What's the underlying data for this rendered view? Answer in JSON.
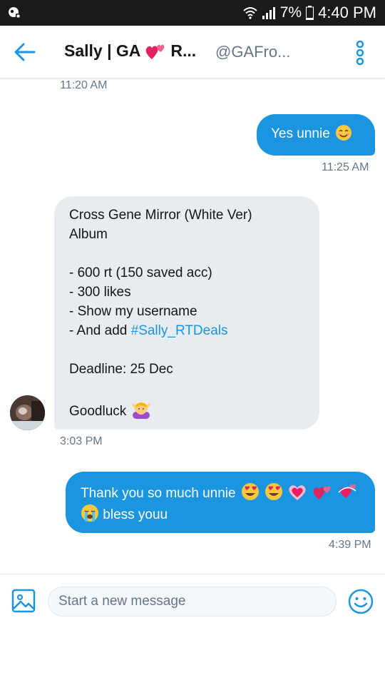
{
  "status_bar": {
    "battery": "7%",
    "time": "4:40 PM"
  },
  "header": {
    "title_start": "Sally | GA",
    "title_end": "R...",
    "handle": "@GAFro..."
  },
  "messages": [
    {
      "direction": "in",
      "timestamp": "11:20 AM"
    },
    {
      "direction": "out",
      "text": "Yes unnie",
      "emoji": "smiling-face-icon",
      "timestamp": "11:25 AM"
    },
    {
      "direction": "in",
      "lines": [
        "Cross Gene Mirror (White Ver)",
        "Album",
        "",
        "- 600 rt (150 saved acc)",
        "- 300 likes",
        "- Show my username",
        "- And add",
        "",
        "Deadline: 25 Dec",
        "",
        "Goodluck"
      ],
      "hashtag": "#Sally_RTDeals",
      "timestamp": "3:03 PM"
    },
    {
      "direction": "out",
      "line1": "Thank you so much unnie",
      "line2": "bless youu",
      "timestamp": "4:39 PM"
    }
  ],
  "composer": {
    "placeholder": "Start a new message"
  },
  "colors": {
    "accent": "#1b95e0",
    "incoming_bubble": "#e6ecf0",
    "muted_text": "#657786",
    "status_bar": "#1a1a1a"
  }
}
